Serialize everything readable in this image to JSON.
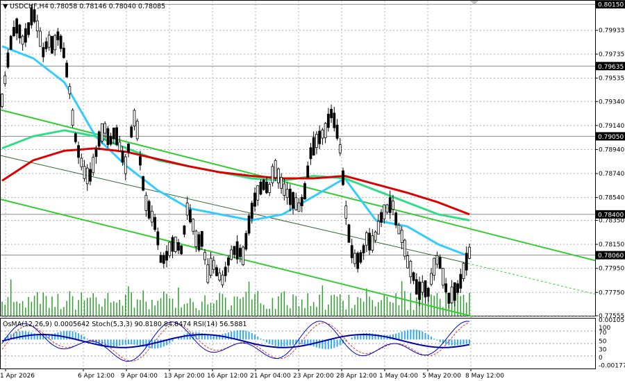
{
  "header": {
    "symbol": "USDCHF,H4",
    "prices": "0.78058 0.78146 0.78040 0.78085",
    "indicators": "OsMA(12,26,9) 0.0005642   Stoch(5,3,3) 90.8180 84.8474   RSI(14) 56.5881"
  },
  "colors": {
    "background": "#ffffff",
    "grid": "#b0b0b0",
    "candle": "#000000",
    "volume": "#2e9e2e",
    "ma_fast": "#33ccff",
    "ma_mid": "#33dd88",
    "ma_slow": "#dd0000",
    "channel": "#33cc33",
    "osma": "#33aaee",
    "stoch_main": "#0000cc",
    "stoch_signal": "#dd3333",
    "rsi": "#0000aa",
    "price_tag": "#000000"
  },
  "chart_data": [
    {
      "type": "candlestick",
      "instrument": "USDCHF",
      "timeframe": "H4",
      "x_labels": [
        "1 Apr 2026",
        "6 Apr 12:00",
        "9 Apr 04:00",
        "13 Apr 20:00",
        "16 Apr 12:00",
        "21 Apr 04:00",
        "23 Apr 20:00",
        "28 Apr 12:00",
        "1 May 04:00",
        "5 May 20:00",
        "8 May 12:00"
      ],
      "y_ticks": [
        "0.79933",
        "0.79735",
        "0.79535",
        "0.79340",
        "0.79140",
        "0.78940",
        "0.78740",
        "0.78540",
        "0.78350",
        "0.78150",
        "0.77950",
        "0.77750",
        "0.77555"
      ],
      "ylim": [
        0.77555,
        0.8018
      ],
      "marked_levels": [
        "0.80150",
        "0.79635",
        "0.79050",
        "0.78400",
        "0.78060"
      ],
      "close_path": [
        0.7935,
        0.7965,
        0.799,
        0.7998,
        0.7985,
        0.7992,
        0.801,
        0.7995,
        0.7975,
        0.7985,
        0.798,
        0.799,
        0.7975,
        0.795,
        0.791,
        0.789,
        0.7875,
        0.787,
        0.7885,
        0.7905,
        0.7912,
        0.79,
        0.791,
        0.7895,
        0.788,
        0.7905,
        0.7925,
        0.788,
        0.785,
        0.784,
        0.783,
        0.78,
        0.7805,
        0.7815,
        0.7815,
        0.781,
        0.7845,
        0.7835,
        0.7815,
        0.782,
        0.779,
        0.78,
        0.779,
        0.7785,
        0.78,
        0.781,
        0.781,
        0.7805,
        0.783,
        0.785,
        0.786,
        0.7865,
        0.786,
        0.788,
        0.787,
        0.786,
        0.7855,
        0.785,
        0.7845,
        0.786,
        0.789,
        0.79,
        0.7905,
        0.791,
        0.7925,
        0.7915,
        0.789,
        0.784,
        0.781,
        0.78,
        0.7805,
        0.782,
        0.7815,
        0.7825,
        0.784,
        0.7845,
        0.785,
        0.783,
        0.782,
        0.78,
        0.779,
        0.7775,
        0.778,
        0.7775,
        0.7795,
        0.7805,
        0.7785,
        0.777,
        0.7775,
        0.778,
        0.7795,
        0.7808
      ],
      "series": [
        {
          "name": "",
          "values": [
            0.798,
            0.797,
            0.795,
            0.7905,
            0.788,
            0.786,
            0.7845,
            0.784,
            0.7835,
            0.784,
            0.7855,
            0.787,
            0.7835,
            0.783,
            0.7815,
            0.7805
          ]
        },
        {
          "name": "",
          "values": [
            0.7895,
            0.7905,
            0.791,
            0.7905,
            0.7895,
            0.7885,
            0.788,
            0.7875,
            0.787,
            0.7868,
            0.7872,
            0.787,
            0.786,
            0.785,
            0.784,
            0.7835
          ]
        },
        {
          "name": "",
          "values": [
            0.7868,
            0.7885,
            0.7893,
            0.7895,
            0.7892,
            0.7886,
            0.788,
            0.7875,
            0.7872,
            0.787,
            0.787,
            0.7872,
            0.7865,
            0.7858,
            0.785,
            0.784
          ]
        }
      ]
    },
    {
      "type": "oscillator",
      "name": "OsMA / Stochastic / RSI",
      "y_ticks": [
        "0.00105",
        "100",
        "70",
        "50",
        "30",
        "0",
        "-0.00177"
      ],
      "osma_range": [
        -0.00177,
        0.00105
      ]
    }
  ]
}
